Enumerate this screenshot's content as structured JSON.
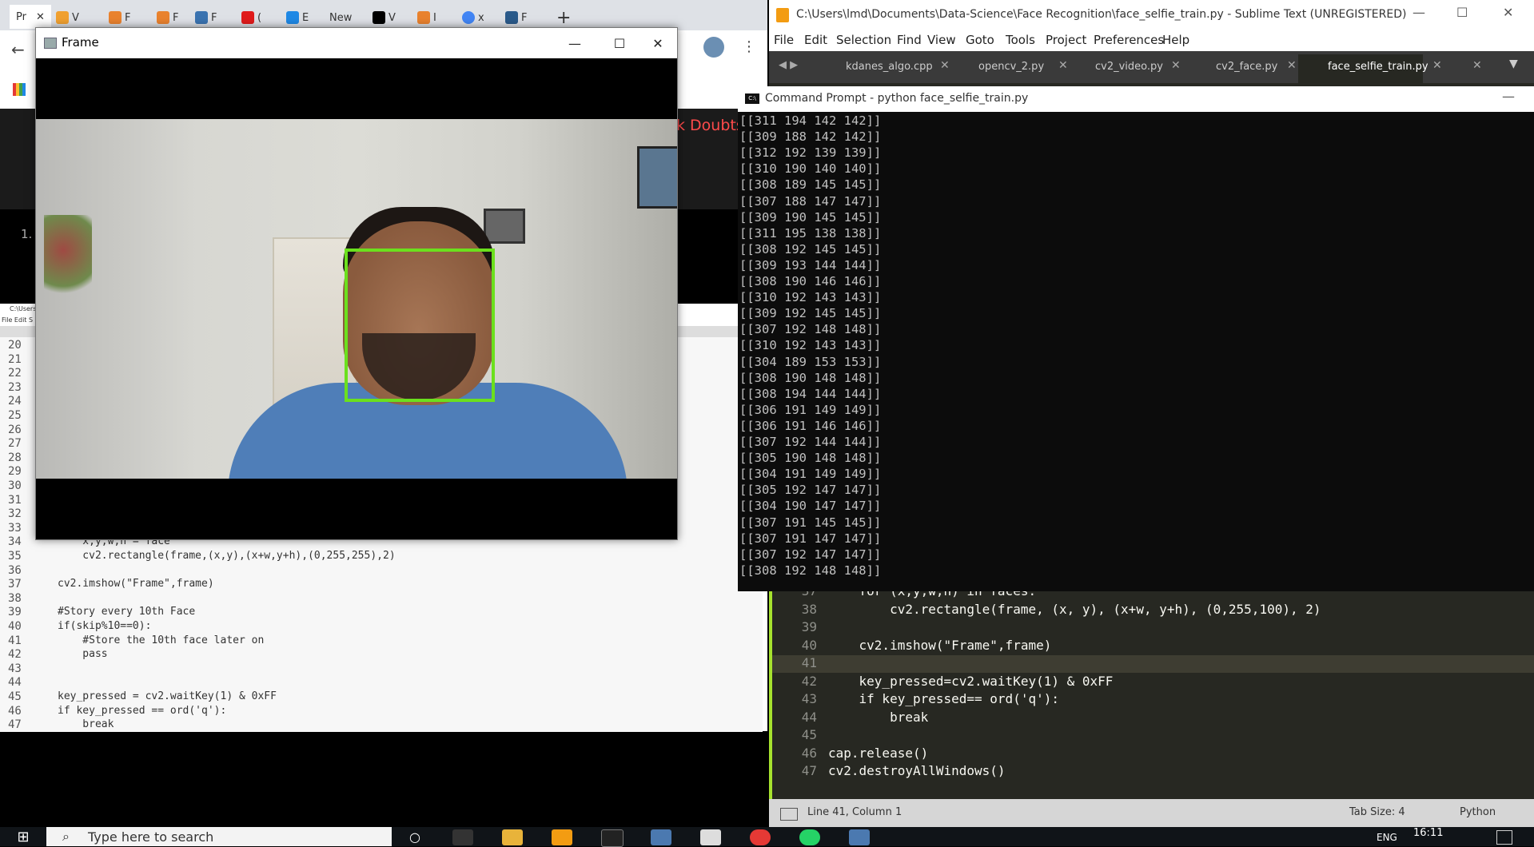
{
  "chrome": {
    "tabs": [
      "Pr",
      "V",
      "F",
      "F",
      "F",
      "(",
      "E",
      "New",
      "V",
      "I",
      "x",
      "F"
    ],
    "header_text": "k Doubts",
    "band_number": "1."
  },
  "left_editor": {
    "title": "C:\\Users",
    "menu": "File Edit S",
    "line_numbers": [
      "20",
      "21",
      "22",
      "23",
      "24",
      "25",
      "26",
      "27",
      "28",
      "29",
      "30",
      "31",
      "32",
      "33",
      "34",
      "35",
      "36",
      "37",
      "38",
      "39",
      "40",
      "41",
      "42",
      "43",
      "44",
      "45",
      "46",
      "47"
    ],
    "lines": [
      {
        "text": "    x,y,w,h = face"
      },
      {
        "text": "    cv2.rectangle(frame,(x,y),(x+w,y+h),(0,255,255),2)"
      },
      {
        "text": ""
      },
      {
        "text": "cv2.imshow(\"Frame\",frame)"
      },
      {
        "text": ""
      },
      {
        "text": "#Story every 10th Face"
      },
      {
        "text": "if(skip%10==0):"
      },
      {
        "text": "    #Store the 10th face later on"
      },
      {
        "text": "    pass"
      },
      {
        "text": ""
      },
      {
        "text": ""
      },
      {
        "text": "key_pressed = cv2.waitKey(1) & 0xFF"
      },
      {
        "text": "if key_pressed == ord('q'):"
      },
      {
        "text": "    break"
      }
    ]
  },
  "frame_window": {
    "title": "Frame",
    "minimize": "—",
    "maximize": "☐",
    "close": "✕"
  },
  "sublime": {
    "title": "C:\\Users\\lmd\\Documents\\Data-Science\\Face Recognition\\face_selfie_train.py - Sublime Text (UNREGISTERED)",
    "menu": [
      "File",
      "Edit",
      "Selection",
      "Find",
      "View",
      "Goto",
      "Tools",
      "Project",
      "Preferences",
      "Help"
    ],
    "tabs": [
      "kdanes_algo.cpp",
      "opencv_2.py",
      "cv2_video.py",
      "cv2_face.py",
      "face_selfie_train.py"
    ],
    "code": [
      {
        "n": "37",
        "text": "    for (x,y,w,h) in faces:"
      },
      {
        "n": "38",
        "text": "        cv2.rectangle(frame, (x, y), (x+w, y+h), (0,255,100), 2)"
      },
      {
        "n": "39",
        "text": ""
      },
      {
        "n": "40",
        "text": "    cv2.imshow(\"Frame\",frame)"
      },
      {
        "n": "41",
        "text": ""
      },
      {
        "n": "42",
        "text": "    key_pressed=cv2.waitKey(1) & 0xFF"
      },
      {
        "n": "43",
        "text": "    if key_pressed== ord('q'):"
      },
      {
        "n": "44",
        "text": "        break"
      },
      {
        "n": "45",
        "text": ""
      },
      {
        "n": "46",
        "text": "cap.release()"
      },
      {
        "n": "47",
        "text": "cv2.destroyAllWindows()"
      }
    ],
    "status_position": "Line 41, Column 1",
    "status_tabsize": "Tab Size: 4",
    "status_syntax": "Python"
  },
  "cmd": {
    "title": "Command Prompt - python  face_selfie_train.py",
    "icon_text": "C:\\",
    "lines": [
      "[[311 194 142 142]]",
      "[[309 188 142 142]]",
      "[[312 192 139 139]]",
      "[[310 190 140 140]]",
      "[[308 189 145 145]]",
      "[[307 188 147 147]]",
      "[[309 190 145 145]]",
      "[[311 195 138 138]]",
      "[[308 192 145 145]]",
      "[[309 193 144 144]]",
      "[[308 190 146 146]]",
      "[[310 192 143 143]]",
      "[[309 192 145 145]]",
      "[[307 192 148 148]]",
      "[[310 192 143 143]]",
      "[[304 189 153 153]]",
      "[[308 190 148 148]]",
      "[[308 194 144 144]]",
      "[[306 191 149 149]]",
      "[[306 191 146 146]]",
      "[[307 192 144 144]]",
      "[[305 190 148 148]]",
      "[[304 191 149 149]]",
      "[[305 192 147 147]]",
      "[[304 190 147 147]]",
      "[[307 191 145 145]]",
      "[[307 191 147 147]]",
      "[[307 192 147 147]]",
      "[[308 192 148 148]]"
    ]
  },
  "taskbar": {
    "search_placeholder": "Type here to search",
    "language": "ENG",
    "time": "16:11"
  }
}
